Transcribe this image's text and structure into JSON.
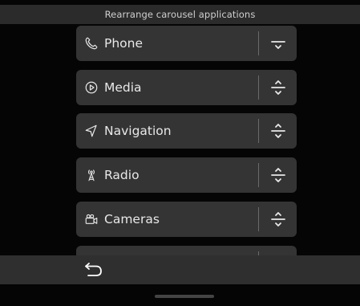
{
  "header": {
    "title": "Rearrange carousel applications"
  },
  "apps": [
    {
      "label": "Phone",
      "icon": "phone-icon",
      "handle": "drag-handle-down-icon"
    },
    {
      "label": "Media",
      "icon": "play-circle-icon",
      "handle": "drag-handle-updown-icon"
    },
    {
      "label": "Navigation",
      "icon": "navigation-arrow-icon",
      "handle": "drag-handle-updown-icon"
    },
    {
      "label": "Radio",
      "icon": "radio-tower-icon",
      "handle": "drag-handle-updown-icon"
    },
    {
      "label": "Cameras",
      "icon": "camera-icon",
      "handle": "drag-handle-updown-icon"
    }
  ],
  "bottom_bar": {
    "back_icon": "back-arrow-icon"
  },
  "colors": {
    "header_bg": "#2b2b2b",
    "item_bg": "#343434",
    "bottom_bg": "#2f2f2f",
    "text": "#e8e8e8"
  }
}
